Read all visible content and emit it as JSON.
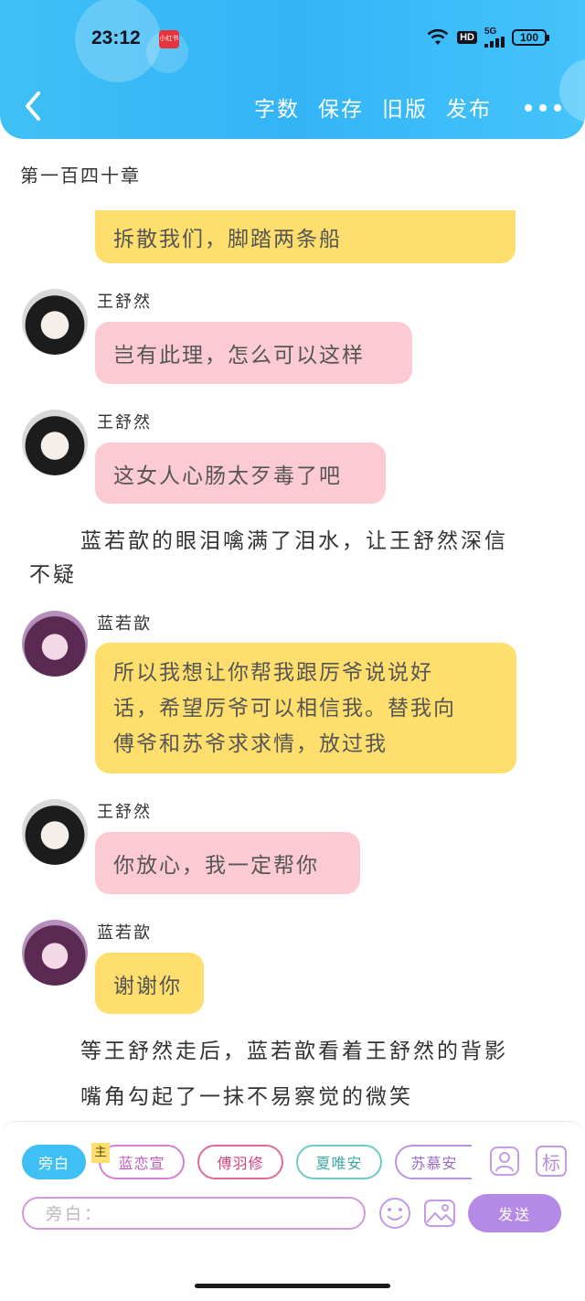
{
  "status_bar": {
    "time": "23:12",
    "app_badge": "小红书",
    "hd_label": "HD",
    "signal_label": "5G",
    "battery": "100"
  },
  "toolbar": {
    "word_count": "字数",
    "save": "保存",
    "old_version": "旧版",
    "publish": "发布"
  },
  "chapter_title": "第一百四十章",
  "messages": [
    {
      "type": "bubble",
      "color": "yellow",
      "text": "拆散我们，脚踏两条船"
    },
    {
      "type": "chat",
      "speaker": "王舒然",
      "color": "pink",
      "text": "岂有此理，怎么可以这样"
    },
    {
      "type": "chat",
      "speaker": "王舒然",
      "color": "pink",
      "text": "这女人心肠太歹毒了吧"
    },
    {
      "type": "narration",
      "lines": [
        "蓝若歆的眼泪噙满了泪水，让王舒然深信",
        "不疑"
      ]
    },
    {
      "type": "chat",
      "speaker": "蓝若歆",
      "color": "yellow",
      "lines": [
        "所以我想让你帮我跟厉爷说说好",
        "话，希望厉爷可以相信我。替我向",
        "傅爷和苏爷求求情，放过我"
      ]
    },
    {
      "type": "chat",
      "speaker": "王舒然",
      "color": "pink",
      "text": "你放心，我一定帮你"
    },
    {
      "type": "chat",
      "speaker": "蓝若歆",
      "color": "yellow",
      "text": "谢谢你"
    },
    {
      "type": "narration",
      "lines": [
        "等王舒然走后，蓝若歆看着王舒然的背影",
        "嘴角勾起了一抹不易察觉的微笑"
      ]
    }
  ],
  "characters": {
    "main_tag": "主",
    "narrator": "旁白",
    "list": [
      "蓝恋宣",
      "傅羽修",
      "夏唯安",
      "苏慕安"
    ]
  },
  "input": {
    "placeholder": "旁白："
  },
  "send_label": "发送",
  "tag_button": "标",
  "colors": {
    "header": "#3fc0f5",
    "yellow_bubble": "#fede6d",
    "pink_bubble": "#fbcad3",
    "send": "#b58ae6"
  }
}
